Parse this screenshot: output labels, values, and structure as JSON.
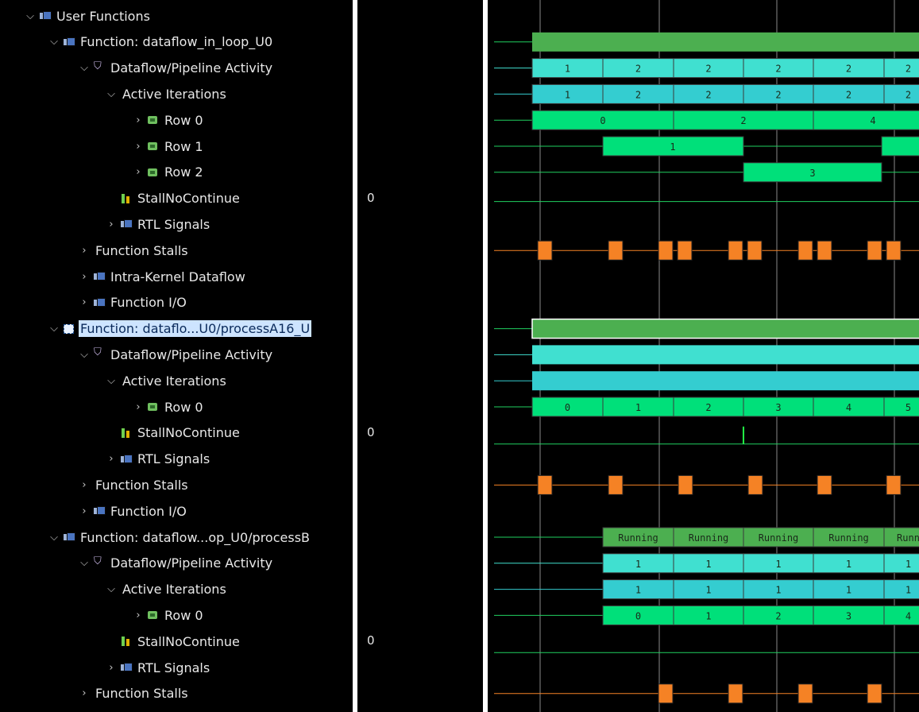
{
  "tree": [
    {
      "indent": 0,
      "chev": "v",
      "icon": "doc",
      "label": "User Functions"
    },
    {
      "indent": 1,
      "chev": "v",
      "icon": "doc",
      "label": "Function: dataflow_in_loop_U0"
    },
    {
      "indent": 2,
      "chev": "v",
      "icon": "df",
      "label": "Dataflow/Pipeline Activity"
    },
    {
      "indent": 3,
      "chev": "v",
      "icon": "",
      "label": "Active Iterations"
    },
    {
      "indent": 4,
      "chev": ">",
      "icon": "rw",
      "label": "Row 0"
    },
    {
      "indent": 4,
      "chev": ">",
      "icon": "rw",
      "label": "Row 1"
    },
    {
      "indent": 4,
      "chev": ">",
      "icon": "rw",
      "label": "Row 2"
    },
    {
      "indent": 3,
      "chev": "",
      "icon": "st",
      "label": "StallNoContinue"
    },
    {
      "indent": 3,
      "chev": ">",
      "icon": "doc",
      "label": "RTL Signals"
    },
    {
      "indent": 2,
      "chev": ">",
      "icon": "",
      "label": "Function Stalls"
    },
    {
      "indent": 2,
      "chev": ">",
      "icon": "doc",
      "label": "Intra-Kernel Dataflow"
    },
    {
      "indent": 2,
      "chev": ">",
      "icon": "doc",
      "label": "Function I/O"
    },
    {
      "indent": 1,
      "chev": "v",
      "icon": "fn",
      "label": "Function: dataflo...U0/processA16_U",
      "selected": true
    },
    {
      "indent": 2,
      "chev": "v",
      "icon": "df",
      "label": "Dataflow/Pipeline Activity"
    },
    {
      "indent": 3,
      "chev": "v",
      "icon": "",
      "label": "Active Iterations"
    },
    {
      "indent": 4,
      "chev": ">",
      "icon": "rw",
      "label": "Row 0"
    },
    {
      "indent": 3,
      "chev": "",
      "icon": "st",
      "label": "StallNoContinue"
    },
    {
      "indent": 3,
      "chev": ">",
      "icon": "doc",
      "label": "RTL Signals"
    },
    {
      "indent": 2,
      "chev": ">",
      "icon": "",
      "label": "Function Stalls"
    },
    {
      "indent": 2,
      "chev": ">",
      "icon": "doc",
      "label": "Function I/O"
    },
    {
      "indent": 1,
      "chev": "v",
      "icon": "doc",
      "label": "Function: dataflow...op_U0/processB"
    },
    {
      "indent": 2,
      "chev": "v",
      "icon": "df",
      "label": "Dataflow/Pipeline Activity"
    },
    {
      "indent": 3,
      "chev": "v",
      "icon": "",
      "label": "Active Iterations"
    },
    {
      "indent": 4,
      "chev": ">",
      "icon": "rw",
      "label": "Row 0"
    },
    {
      "indent": 3,
      "chev": "",
      "icon": "st",
      "label": "StallNoContinue"
    },
    {
      "indent": 3,
      "chev": ">",
      "icon": "doc",
      "label": "RTL Signals"
    },
    {
      "indent": 2,
      "chev": ">",
      "icon": "",
      "label": "Function Stalls"
    }
  ],
  "values": [
    {
      "row": 7,
      "text": "0"
    },
    {
      "row": 16,
      "text": "0"
    },
    {
      "row": 24,
      "text": "0"
    }
  ],
  "colors": {
    "bright_green": "#4caf50",
    "cyan": "#40e0d0",
    "cyan_dark": "#34cdd0",
    "green": "#00e07a",
    "stall": "#f58225",
    "line": "#20d060",
    "grid": "#7a7a7a"
  },
  "waveform": {
    "f1_row1_labels": [
      "1",
      "2",
      "2",
      "2",
      "2",
      "2"
    ],
    "f1_row2_labels": [
      "1",
      "2",
      "2",
      "2",
      "2",
      "2"
    ],
    "f1_row0_labels": [
      "0",
      "2",
      "4"
    ],
    "f1_row1_iter": "1",
    "f1_row2_iter": "3",
    "f2_row0_labels": [
      "0",
      "1",
      "2",
      "3",
      "4",
      "5"
    ],
    "f3_state_labels": [
      "Running",
      "Running",
      "Running",
      "Running",
      "Runn"
    ],
    "f3_row1_labels": [
      "1",
      "1",
      "1",
      "1",
      "1"
    ],
    "f3_row2_labels": [
      "1",
      "1",
      "1",
      "1",
      "1"
    ],
    "f3_row0_labels": [
      "0",
      "1",
      "2",
      "3",
      "4"
    ]
  }
}
